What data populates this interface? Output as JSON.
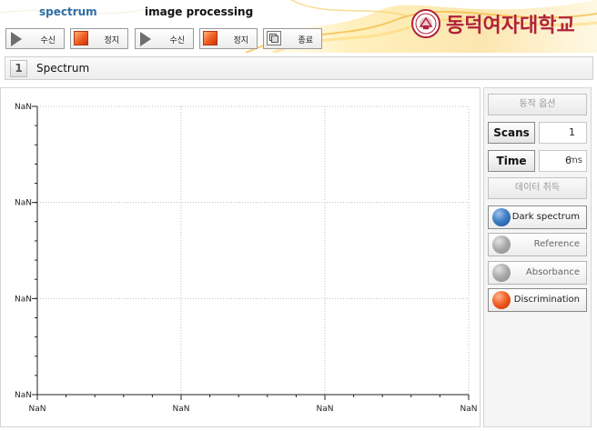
{
  "header": {
    "section_spectrum": "spectrum",
    "section_image": "image processing",
    "logo_text": "동덕여자대학교",
    "accent_color": "#2e6da4",
    "brand_color": "#b0223a"
  },
  "toolbar": {
    "spectrum_receive": "수신",
    "spectrum_stop": "정지",
    "image_receive": "수신",
    "image_stop": "정지",
    "exit": "종료"
  },
  "tab": {
    "number": "1",
    "title": "Spectrum"
  },
  "chart_data": {
    "type": "line",
    "title": "",
    "xlabel": "",
    "ylabel": "",
    "x_tick_labels": [
      "NaN",
      "NaN",
      "NaN",
      "NaN"
    ],
    "y_tick_labels": [
      "NaN",
      "NaN",
      "NaN",
      "NaN"
    ],
    "series": [],
    "grid": true,
    "grid_style": "dotted"
  },
  "panel": {
    "operation_options": "동작 옵션",
    "scans_label": "Scans",
    "scans_value": "1",
    "time_label": "Time",
    "time_value": "6",
    "time_unit": "ms",
    "acquire_data": "데이터 취득",
    "options": [
      {
        "label": "Dark spectrum",
        "color": "#3f7fc6",
        "enabled": true
      },
      {
        "label": "Reference",
        "color": "#a8a8a8",
        "enabled": false
      },
      {
        "label": "Absorbance",
        "color": "#a8a8a8",
        "enabled": false
      },
      {
        "label": "Discrimination",
        "color": "#f05a1e",
        "enabled": true
      }
    ]
  }
}
